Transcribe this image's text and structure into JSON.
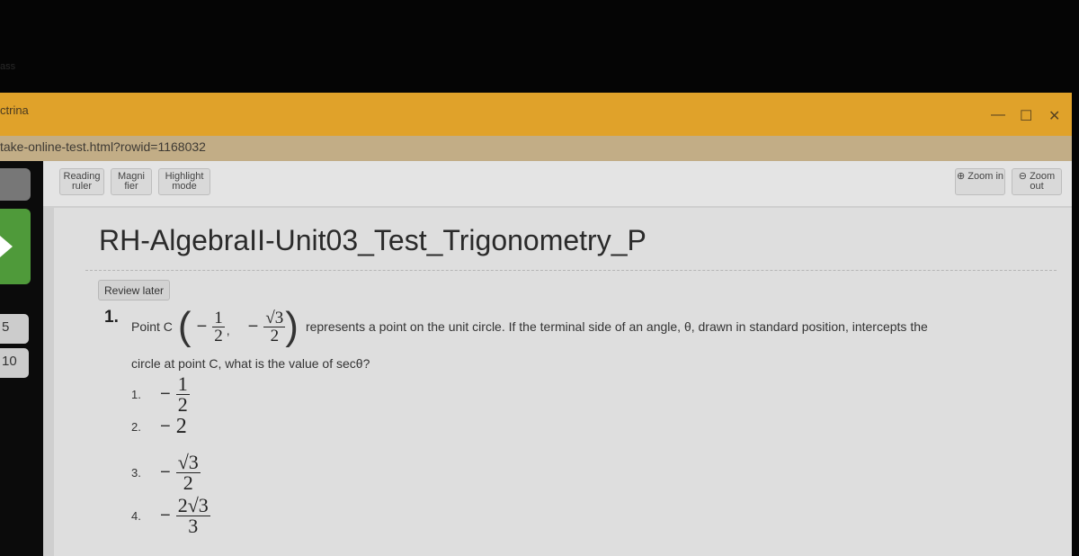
{
  "top_faint_text": "ass",
  "window": {
    "title": "ctrina",
    "minimize": "—",
    "maximize": "☐",
    "close": "✕"
  },
  "url": "take-online-test.html?rowid=1168032",
  "sidebar": {
    "numbers": [
      "5",
      "10"
    ]
  },
  "toolbar": {
    "reading_ruler": "Reading ruler",
    "magnifier": "Magni fier",
    "highlight": "Highlight mode",
    "zoom_in": "Zoom in",
    "zoom_out": "Zoom out"
  },
  "test_title": "RH-AlgebraII-Unit03_Test_Trigonometry_P",
  "review_later": "Review later",
  "question": {
    "number": "1.",
    "prefix": "Point C",
    "x_num": "1",
    "x_den": "2",
    "y_num": "√3",
    "y_den": "2",
    "suffix": "represents a point on the unit circle.  If the terminal side of an angle, θ, drawn in standard position, intercepts the",
    "line2": "circle at point C, what is the value of secθ?",
    "options": [
      {
        "label": "1.",
        "num": "1",
        "den": "2",
        "sign": "−"
      },
      {
        "label": "2.",
        "value": "2",
        "sign": "−"
      },
      {
        "label": "3.",
        "num": "√3",
        "den": "2",
        "sign": "−"
      },
      {
        "label": "4.",
        "num": "2√3",
        "den": "3",
        "sign": "−"
      }
    ]
  }
}
